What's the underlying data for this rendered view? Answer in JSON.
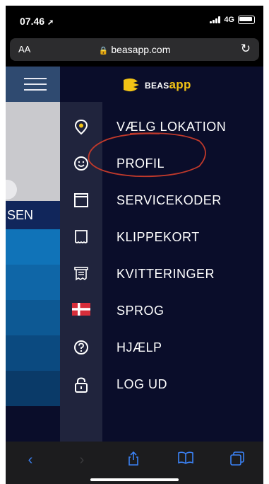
{
  "status_bar": {
    "time": "07.46",
    "network": "4G"
  },
  "browser": {
    "text_size_label": "AA",
    "url": "beasapp.com"
  },
  "left_panel": {
    "partial_text": "SEN"
  },
  "menu": {
    "logo": {
      "brand": "BEAS",
      "brand_suffix": "app",
      "accent": "#f2c315"
    },
    "items": [
      {
        "label": "VÆLG LOKATION",
        "icon": "location-pin-icon"
      },
      {
        "label": "PROFIL",
        "icon": "smiley-icon"
      },
      {
        "label": "SERVICEKODER",
        "icon": "window-icon"
      },
      {
        "label": "KLIPPEKORT",
        "icon": "punch-card-icon"
      },
      {
        "label": "KVITTERINGER",
        "icon": "receipt-icon"
      },
      {
        "label": "SPROG",
        "icon": "danish-flag-icon"
      },
      {
        "label": "HJÆLP",
        "icon": "help-icon"
      },
      {
        "label": "LOG UD",
        "icon": "unlock-icon"
      }
    ]
  },
  "colors": {
    "menu_bg": "#0a0d2a",
    "icon_column": "#20243d",
    "annotation": "#c0392b",
    "toolbar_icon": "#3b82f6"
  }
}
